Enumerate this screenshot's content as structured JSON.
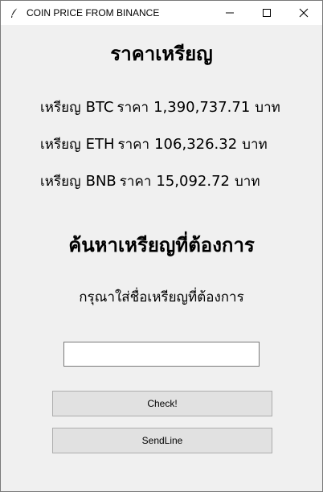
{
  "window": {
    "title": "COIN PRICE FROM BINANCE"
  },
  "prices": {
    "heading": "ราคาเหรียญ",
    "rows": [
      {
        "prefix": "เหรียญ",
        "symbol": "BTC",
        "price_label": "ราคา",
        "value": "1,390,737.71",
        "unit": "บาท"
      },
      {
        "prefix": "เหรียญ",
        "symbol": "ETH",
        "price_label": "ราคา",
        "value": "106,326.32",
        "unit": "บาท"
      },
      {
        "prefix": "เหรียญ",
        "symbol": "BNB",
        "price_label": "ราคา",
        "value": "15,092.72",
        "unit": "บาท"
      }
    ]
  },
  "search": {
    "heading": "ค้นหาเหรียญที่ต้องการ",
    "prompt": "กรุณาใส่ชื่อเหรียญที่ต้องการ",
    "input_value": ""
  },
  "buttons": {
    "check_label": "Check!",
    "sendline_label": "SendLine"
  }
}
